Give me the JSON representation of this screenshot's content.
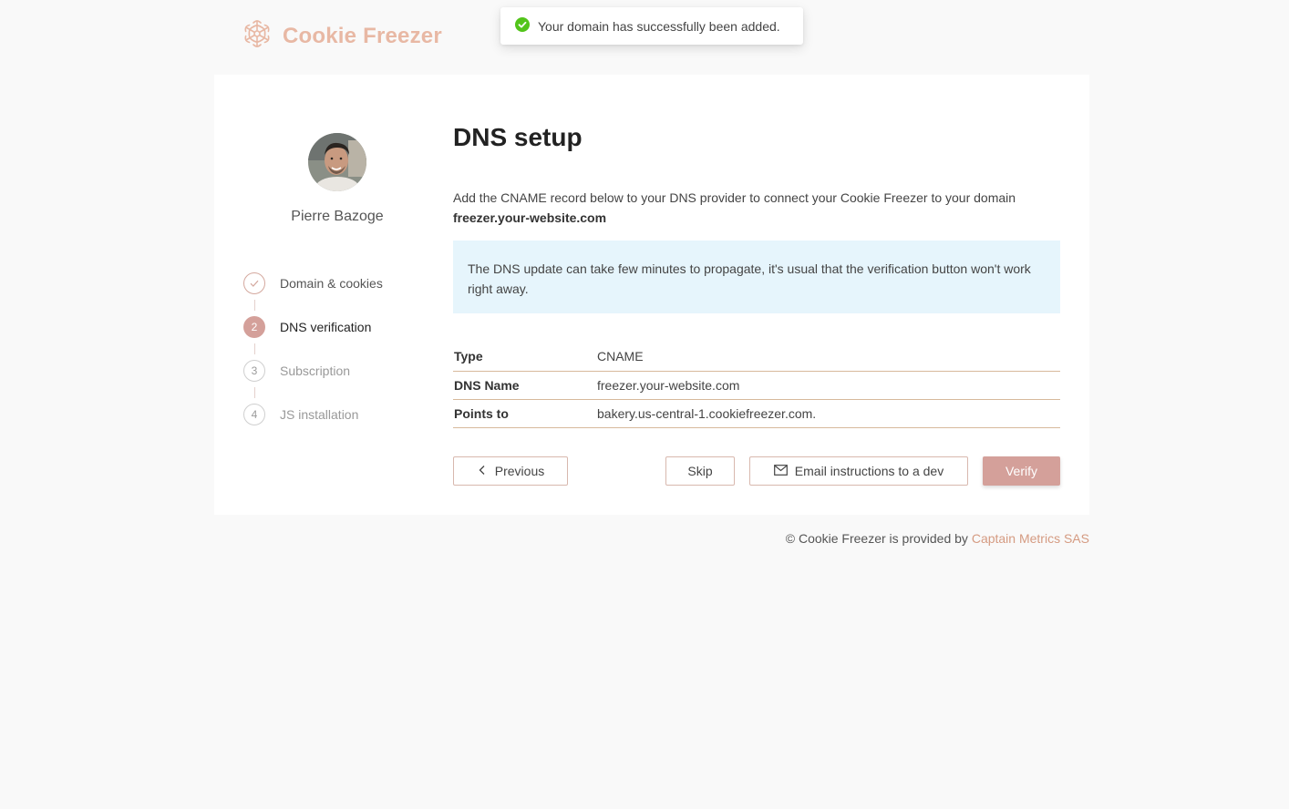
{
  "brand": {
    "name": "Cookie Freezer",
    "logo_icon": "snowflake-icon",
    "accent": "#e8b8a4"
  },
  "toast": {
    "icon": "check-circle-icon",
    "message": "Your domain has successfully been added."
  },
  "user": {
    "name": "Pierre Bazoge",
    "avatar_icon": "user-avatar"
  },
  "steps": [
    {
      "index": "1",
      "label": "Domain & cookies",
      "status": "done"
    },
    {
      "index": "2",
      "label": "DNS verification",
      "status": "active"
    },
    {
      "index": "3",
      "label": "Subscription",
      "status": "todo"
    },
    {
      "index": "4",
      "label": "JS installation",
      "status": "todo"
    }
  ],
  "main": {
    "title": "DNS setup",
    "description": "Add the CNAME record below to your DNS provider to connect your Cookie Freezer to your domain",
    "domain": "freezer.your-website.com",
    "info": "The DNS update can take few minutes to propagate, it's usual that the verification button won't work right away.",
    "dns_records": [
      {
        "key": "Type",
        "value": "CNAME"
      },
      {
        "key": "DNS Name",
        "value": "freezer.your-website.com"
      },
      {
        "key": "Points to",
        "value": "bakery.us-central-1.cookiefreezer.com."
      }
    ]
  },
  "buttons": {
    "previous": "Previous",
    "skip": "Skip",
    "email": "Email instructions to a dev",
    "verify": "Verify"
  },
  "footer": {
    "text": "© Cookie Freezer is provided by",
    "link": "Captain Metrics SAS",
    "link_color": "#d59b82"
  }
}
